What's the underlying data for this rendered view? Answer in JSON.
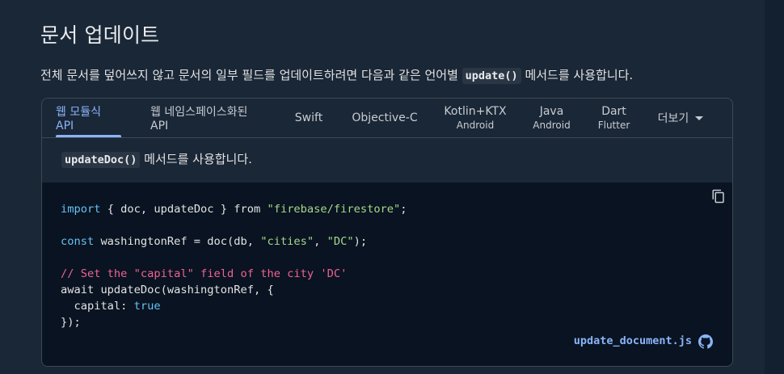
{
  "page": {
    "title": "문서 업데이트",
    "intro_before": "전체 문서를 덮어쓰지 않고 문서의 일부 필드를 업데이트하려면 다음과 같은 언어별 ",
    "intro_code": "update()",
    "intro_after": " 메서드를 사용합니다."
  },
  "tabs": [
    {
      "label": "웹 모듈식 API",
      "active": true
    },
    {
      "label": "웹 네임스페이스화된 API"
    },
    {
      "label": "Swift"
    },
    {
      "label": "Objective-C"
    },
    {
      "label": "Kotlin+KTX",
      "sub": "Android"
    },
    {
      "label": "Java",
      "sub": "Android"
    },
    {
      "label": "Dart",
      "sub": "Flutter"
    },
    {
      "label": "더보기"
    }
  ],
  "tab_content": {
    "method_code": "updateDoc()",
    "method_text": " 메서드를 사용합니다.",
    "code_lines": [
      {
        "kw": "import",
        "rest": " { doc, updateDoc } from ",
        "str": "\"firebase/firestore\"",
        "end": ";"
      },
      {
        "kw": "const",
        "rest": " washingtonRef = doc(db, ",
        "str1": "\"cities\"",
        "sep": ", ",
        "str2": "\"DC\"",
        "end": ");"
      },
      {
        "comment": "// Set the \"capital\" field of the city 'DC'"
      },
      {
        "plain": "await updateDoc(washingtonRef, {"
      },
      {
        "plain": "  capital: ",
        "kw_value": "true"
      },
      {
        "plain": "});"
      }
    ],
    "file_link": "update_document.js"
  },
  "colors": {
    "accent": "#8ab4f8",
    "keyword": "#66c2f2",
    "string": "#a8d88a",
    "comment": "#f06292",
    "code_bg": "#091321"
  },
  "icons": {
    "copy": "copy-icon",
    "github": "github-icon",
    "more": "chevron-down-icon"
  }
}
